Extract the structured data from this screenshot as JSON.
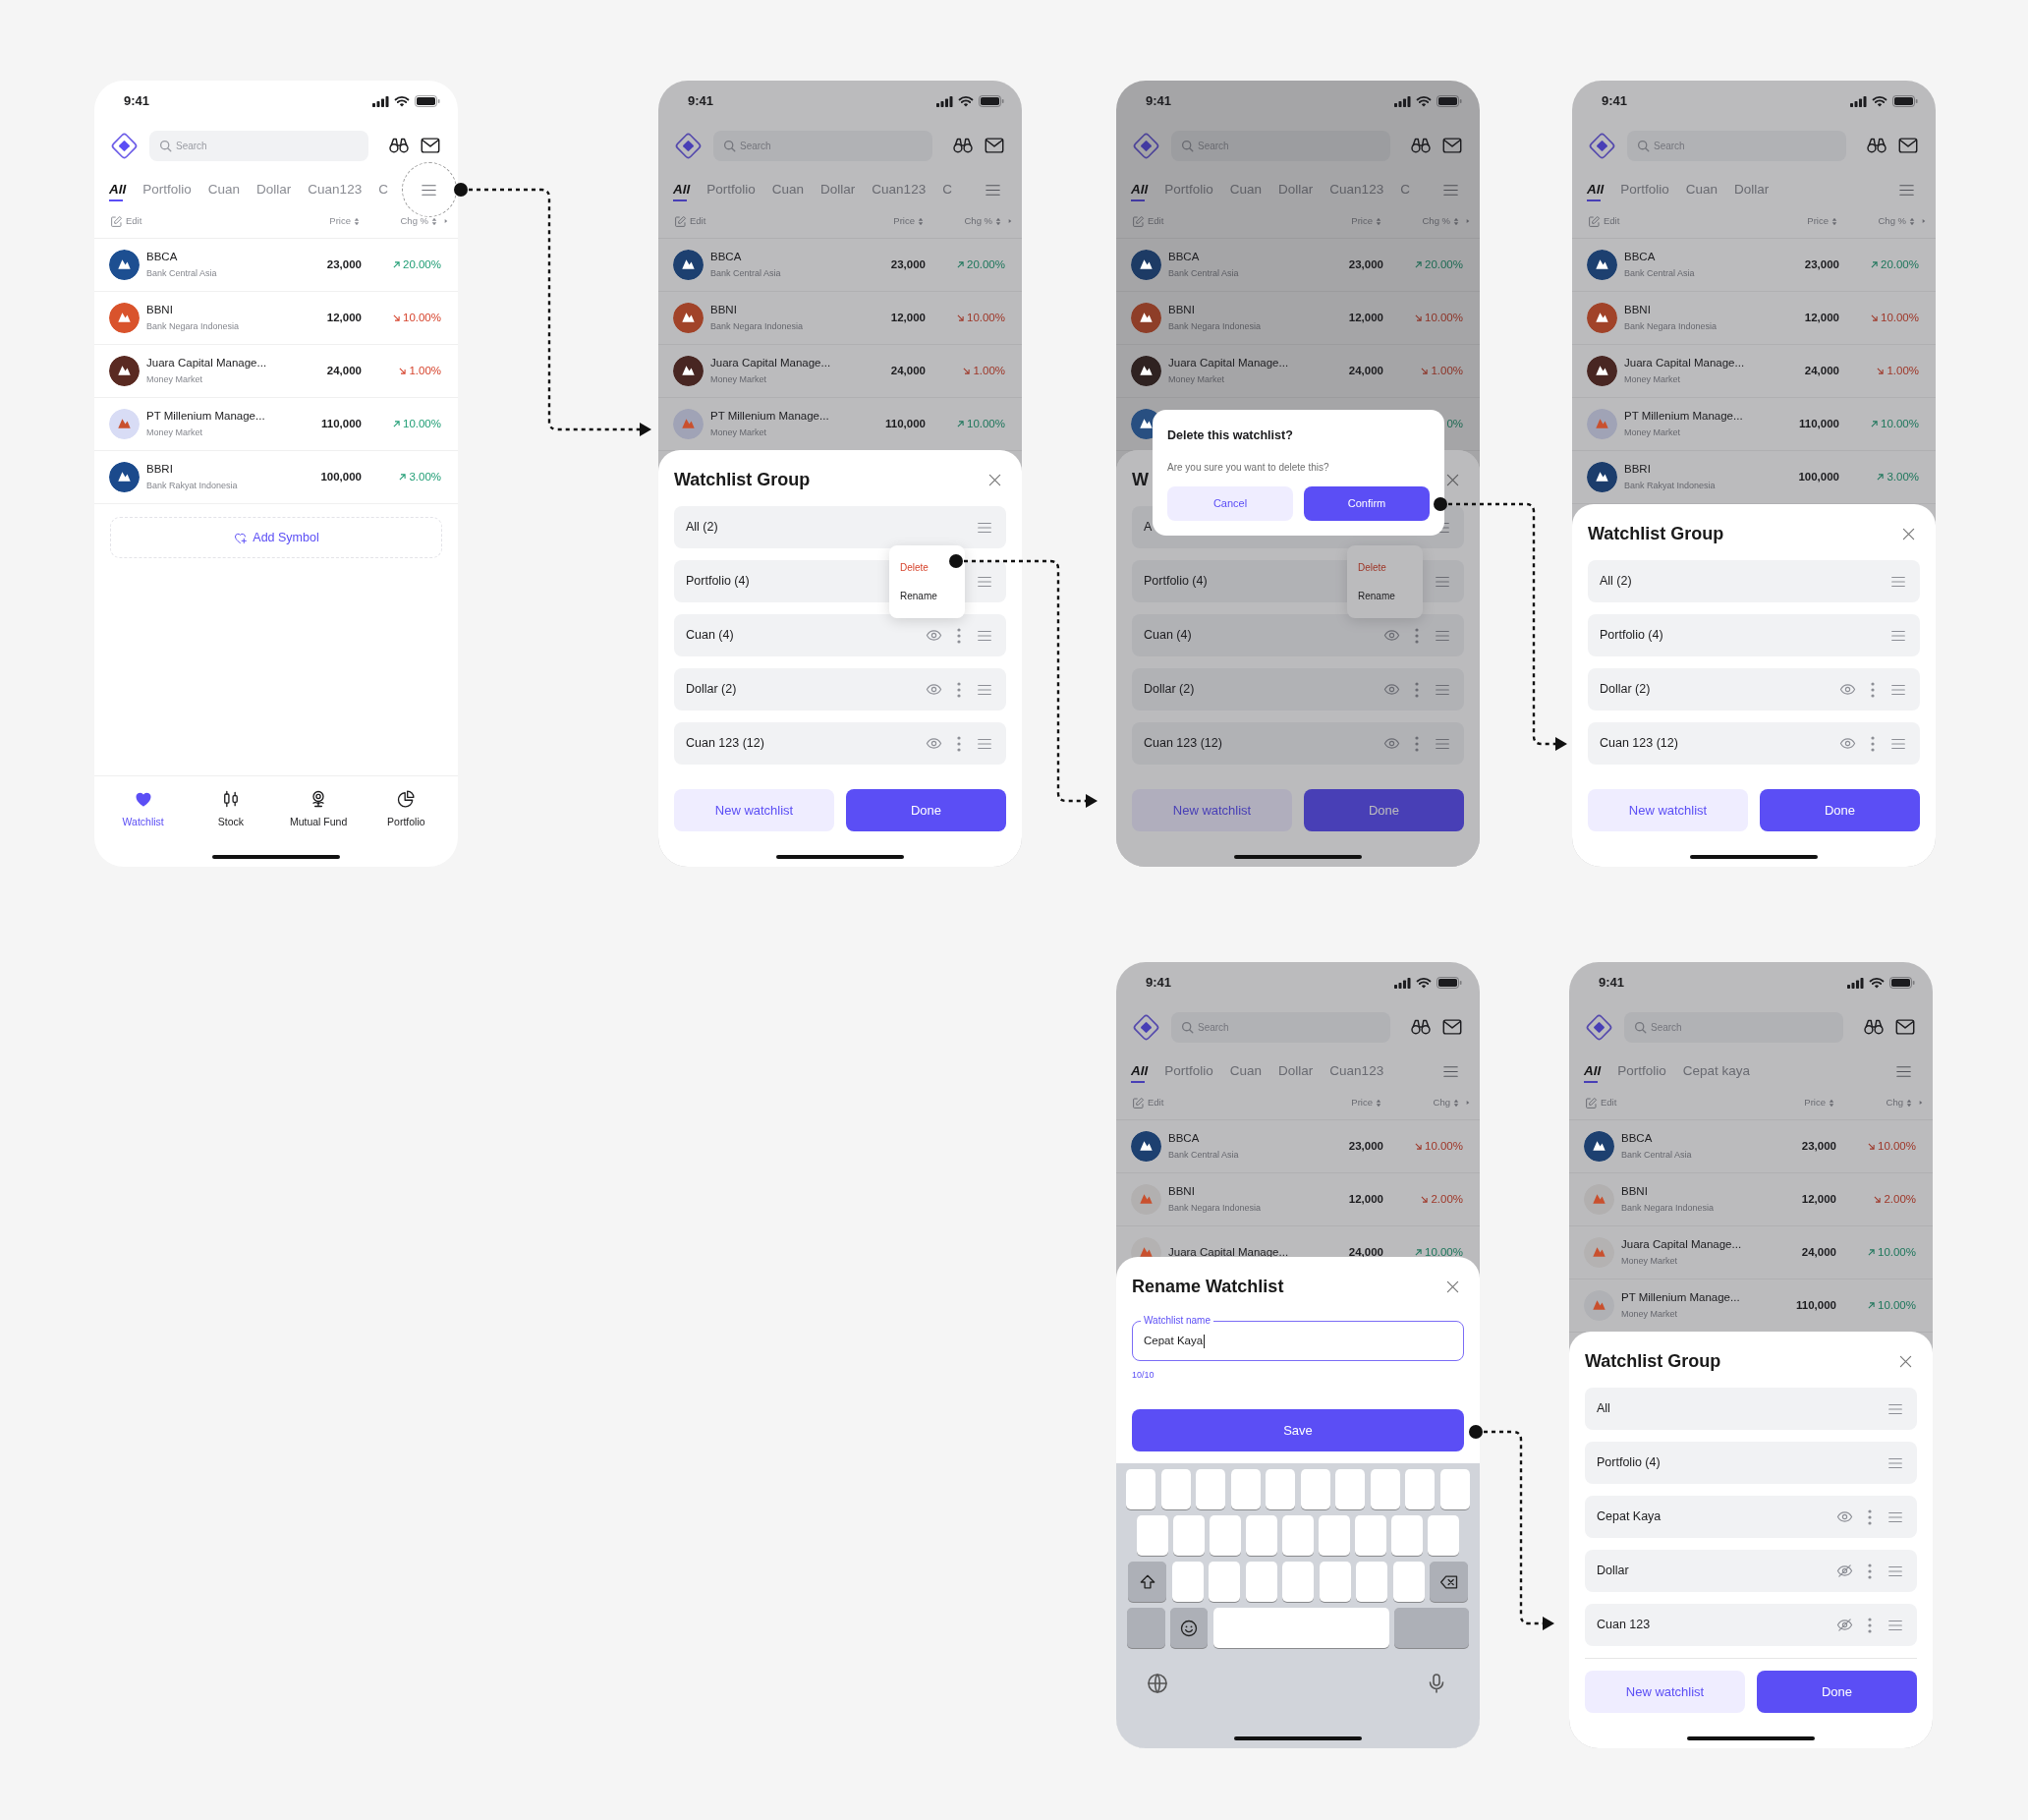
{
  "screens": [
    {
      "status_time": "9:41",
      "search": {
        "placeholder": "Search"
      },
      "tabs": [
        {
          "label": "All",
          "selected": true
        },
        {
          "label": "Portfolio",
          "selected": false
        },
        {
          "label": "Cuan",
          "selected": false
        },
        {
          "label": "Dollar",
          "selected": false
        },
        {
          "label": "Cuan123",
          "selected": false
        },
        {
          "label": "C",
          "selected": false
        }
      ],
      "menu_highlighted": true,
      "table": {
        "header": {
          "edit": "Edit",
          "price": "Price",
          "change": "Chg %"
        },
        "rows": [
          {
            "name": "BBCA",
            "sub": "Bank Central Asia",
            "price": "23,000",
            "change": "20.00%",
            "kind": "up",
            "color": "#1d4f91"
          },
          {
            "name": "BBNI",
            "sub": "Bank Negara Indonesia",
            "price": "12,000",
            "change": "10.00%",
            "kind": "down",
            "color": "#d9532c"
          },
          {
            "name": "Juara Capital Manage...",
            "sub": "Money Market",
            "price": "24,000",
            "change": "1.00%",
            "kind": "down",
            "color": "#5a2a22"
          },
          {
            "name": "PT Millenium Manage...",
            "sub": "Money Market",
            "price": "110,000",
            "change": "10.00%",
            "kind": "up",
            "color": "#d8dcf5"
          },
          {
            "name": "BBRI",
            "sub": "Bank Rakyat Indonesia",
            "price": "100,000",
            "change": "3.00%",
            "kind": "up",
            "color": "#1b4a8c"
          }
        ]
      },
      "add_symbol": "Add Symbol",
      "bottom_nav": [
        {
          "label": "Watchlist",
          "selected": true
        },
        {
          "label": "Stock",
          "selected": false
        },
        {
          "label": "Mutual Fund",
          "selected": false
        },
        {
          "label": "Portfolio",
          "selected": false
        }
      ]
    },
    {
      "status_time": "9:41",
      "search": {
        "placeholder": "Search"
      },
      "tabs": [
        {
          "label": "All",
          "selected": true
        },
        {
          "label": "Portfolio",
          "selected": false
        },
        {
          "label": "Cuan",
          "selected": false
        },
        {
          "label": "Dollar",
          "selected": false
        },
        {
          "label": "Cuan123",
          "selected": false
        },
        {
          "label": "C",
          "selected": false
        }
      ],
      "table": {
        "header": {
          "edit": "Edit",
          "price": "Price",
          "change": "Chg %"
        },
        "rows": [
          {
            "name": "BBCA",
            "sub": "Bank Central Asia",
            "price": "23,000",
            "change": "20.00%",
            "kind": "up",
            "color": "#1d4070"
          },
          {
            "name": "BBNI",
            "sub": "Bank Negara Indonesia",
            "price": "12,000",
            "change": "10.00%",
            "kind": "down",
            "color": "#a14329"
          },
          {
            "name": "Juara Capital Manage...",
            "sub": "Money Market",
            "price": "24,000",
            "change": "1.00%",
            "kind": "down",
            "color": "#482622"
          },
          {
            "name": "PT Millenium Manage...",
            "sub": "Money Market",
            "price": "110,000",
            "change": "10.00%",
            "kind": "up",
            "color": "#a0a3b6"
          }
        ]
      },
      "sheet": {
        "kind": "group",
        "title": "Watchlist Group",
        "items": [
          {
            "label": "All (2)",
            "kind": "fixed"
          },
          {
            "label": "Portfolio (4)",
            "kind": "fixed",
            "menu": [
              {
                "label": "Delete",
                "danger": true
              },
              {
                "label": "Rename",
                "danger": false
              }
            ]
          },
          {
            "label": "Cuan (4)",
            "kind": "custom",
            "visible": true
          },
          {
            "label": "Dollar (2)",
            "kind": "custom",
            "visible": true
          },
          {
            "label": "Cuan 123 (12)",
            "kind": "custom",
            "visible": true
          }
        ],
        "buttons": {
          "secondary": "New watchlist",
          "primary": "Done"
        }
      }
    },
    {
      "status_time": "9:41",
      "search": {
        "placeholder": "Search"
      },
      "tabs": [
        {
          "label": "All",
          "selected": true
        },
        {
          "label": "Portfolio",
          "selected": false
        },
        {
          "label": "Cuan",
          "selected": false
        },
        {
          "label": "Dollar",
          "selected": false
        },
        {
          "label": "Cuan123",
          "selected": false
        },
        {
          "label": "C",
          "selected": false
        }
      ],
      "table": {
        "header": {
          "edit": "Edit",
          "price": "Price",
          "change": "Chg %"
        },
        "rows": [
          {
            "name": "BBCA",
            "sub": "Bank Central Asia",
            "price": "23,000",
            "change": "20.00%",
            "kind": "up",
            "color": "#1d3b65"
          },
          {
            "name": "BBNI",
            "sub": "Bank Negara Indonesia",
            "price": "12,000",
            "change": "10.00%",
            "kind": "down",
            "color": "#8e3e28"
          },
          {
            "name": "Juara Capital Manage...",
            "sub": "Money Market",
            "price": "24,000",
            "change": "1.00%",
            "kind": "down",
            "color": "#2f2221"
          },
          {
            "kind": "partial",
            "change": "0%",
            "color": "#284f81"
          }
        ]
      },
      "sheet": {
        "kind": "group",
        "title": "W",
        "items": [
          {
            "label": "A",
            "kind": "fixed"
          },
          {
            "label": "Portfolio (4)",
            "kind": "fixed",
            "menu": [
              {
                "label": "Delete",
                "danger": true
              },
              {
                "label": "Rename",
                "danger": false
              }
            ]
          },
          {
            "label": "Cuan (4)",
            "kind": "custom",
            "visible": true
          },
          {
            "label": "Dollar (2)",
            "kind": "custom",
            "visible": true
          },
          {
            "label": "Cuan 123 (12)",
            "kind": "custom",
            "visible": true
          }
        ],
        "buttons": {
          "secondary": "New watchlist",
          "primary": "Done"
        }
      },
      "dialog": {
        "title": "Delete this watchlist?",
        "message": "Are you sure you want to delete this?",
        "cancel": "Cancel",
        "confirm": "Confirm"
      }
    },
    {
      "status_time": "9:41",
      "search": {
        "placeholder": "Search"
      },
      "tabs": [
        {
          "label": "All",
          "selected": true
        },
        {
          "label": "Portfolio",
          "selected": false
        },
        {
          "label": "Cuan",
          "selected": false
        },
        {
          "label": "Dollar",
          "selected": false
        }
      ],
      "table": {
        "header": {
          "edit": "Edit",
          "price": "Price",
          "change": "Chg %"
        },
        "rows": [
          {
            "name": "BBCA",
            "sub": "Bank Central Asia",
            "price": "23,000",
            "change": "20.00%",
            "kind": "up",
            "color": "#1d4070"
          },
          {
            "name": "BBNI",
            "sub": "Bank Negara Indonesia",
            "price": "12,000",
            "change": "10.00%",
            "kind": "down",
            "color": "#a14329"
          },
          {
            "name": "Juara Capital Manage...",
            "sub": "Money Market",
            "price": "24,000",
            "change": "1.00%",
            "kind": "down",
            "color": "#482622"
          },
          {
            "name": "PT Millenium Manage...",
            "sub": "Money Market",
            "price": "110,000",
            "change": "10.00%",
            "kind": "up",
            "color": "#a0a3b6"
          },
          {
            "name": "BBRI",
            "sub": "Bank Rakyat Indonesia",
            "price": "100,000",
            "change": "3.00%",
            "kind": "up",
            "color": "#1c3d6c"
          }
        ]
      },
      "sheet": {
        "kind": "group",
        "title": "Watchlist Group",
        "items": [
          {
            "label": "All (2)",
            "kind": "fixed"
          },
          {
            "label": "Portfolio (4)",
            "kind": "fixed"
          },
          {
            "label": "Dollar (2)",
            "kind": "custom",
            "visible": true
          },
          {
            "label": "Cuan 123 (12)",
            "kind": "custom",
            "visible": true
          }
        ],
        "buttons": {
          "secondary": "New watchlist",
          "primary": "Done"
        }
      }
    },
    {
      "status_time": "9:41",
      "search": {
        "placeholder": "Search"
      },
      "tabs": [
        {
          "label": "All",
          "selected": true
        },
        {
          "label": "Portfolio",
          "selected": false
        },
        {
          "label": "Cuan",
          "selected": false
        },
        {
          "label": "Dollar",
          "selected": false
        },
        {
          "label": "Cuan123",
          "selected": false
        }
      ],
      "table": {
        "header": {
          "edit": "Edit",
          "price": "Price",
          "change": "Chg"
        },
        "rows": [
          {
            "name": "BBCA",
            "sub": "Bank Central Asia",
            "price": "23,000",
            "change": "10.00%",
            "kind": "down",
            "color": "#1d4070"
          },
          {
            "name": "BBNI",
            "sub": "Bank Negara Indonesia",
            "price": "12,000",
            "change": "2.00%",
            "kind": "down",
            "color": "#b2b0b0"
          },
          {
            "name": "Juara Capital Manage...",
            "price": "24,000",
            "change": "10.00%",
            "kind": "up",
            "color": "#b4b2b2"
          }
        ]
      },
      "sheet": {
        "kind": "rename",
        "title": "Rename Watchlist",
        "field": {
          "label": "Watchlist name",
          "value": "Cepat Kaya",
          "counter": "10/10"
        },
        "button": "Save",
        "keyboard": true
      }
    },
    {
      "status_time": "9:41",
      "search": {
        "placeholder": "Search"
      },
      "tabs": [
        {
          "label": "All",
          "selected": true
        },
        {
          "label": "Portfolio",
          "selected": false
        },
        {
          "label": "Cepat kaya",
          "selected": false
        }
      ],
      "table": {
        "header": {
          "edit": "Edit",
          "price": "Price",
          "change": "Chg"
        },
        "rows": [
          {
            "name": "BBCA",
            "sub": "Bank Central Asia",
            "price": "23,000",
            "change": "10.00%",
            "kind": "down",
            "color": "#1d4070"
          },
          {
            "name": "BBNI",
            "sub": "Bank Negara Indonesia",
            "price": "12,000",
            "change": "2.00%",
            "kind": "down",
            "color": "#b2b0b0"
          },
          {
            "name": "Juara Capital Manage...",
            "sub": "Money Market",
            "price": "24,000",
            "change": "10.00%",
            "kind": "up",
            "color": "#b4b2b2"
          },
          {
            "name": "PT Millenium Manage...",
            "sub": "Money Market",
            "price": "110,000",
            "change": "10.00%",
            "kind": "up",
            "color": "#b0b1b5"
          }
        ]
      },
      "sheet": {
        "kind": "group",
        "title": "Watchlist Group",
        "footer_divider": true,
        "items": [
          {
            "label": "All",
            "kind": "fixed"
          },
          {
            "label": "Portfolio (4)",
            "kind": "fixed"
          },
          {
            "label": "Cepat Kaya",
            "kind": "custom",
            "visible": true
          },
          {
            "label": "Dollar",
            "kind": "custom",
            "visible": false
          },
          {
            "label": "Cuan 123",
            "kind": "custom",
            "visible": false
          }
        ],
        "buttons": {
          "secondary": "New watchlist",
          "primary": "Done"
        }
      }
    }
  ]
}
